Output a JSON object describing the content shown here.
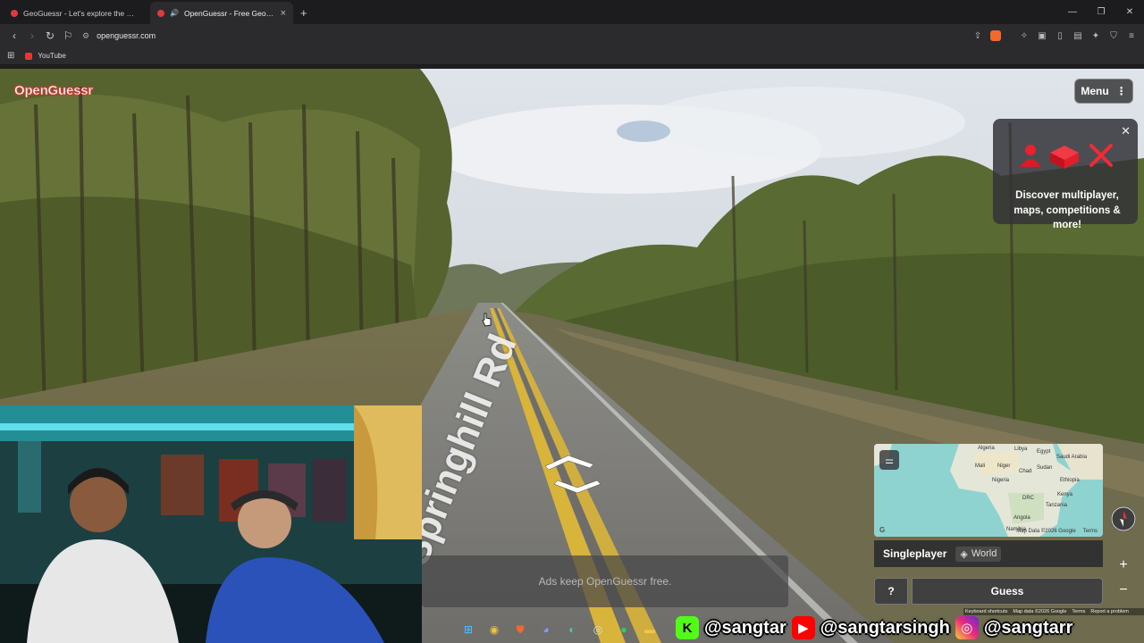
{
  "browser": {
    "tabs": [
      {
        "title": "GeoGuessr - Let's explore the world!",
        "active": false
      },
      {
        "title": "OpenGuessr - Free GeoGuessr",
        "active": true
      }
    ],
    "url": "openguessr.com",
    "bookmarks": [
      {
        "label": "YouTube"
      }
    ]
  },
  "game": {
    "logo": "OpenGuessr",
    "menu_label": "Menu",
    "promo_text": "Discover multiplayer, maps, competitions & more!",
    "road_name": "Springhill Rd",
    "ads_text": "Ads keep OpenGuessr free.",
    "mode": "Singleplayer",
    "map_name": "World",
    "help_label": "?",
    "guess_label": "Guess",
    "minimap": {
      "labels": [
        "Algeria",
        "Libya",
        "Egypt",
        "Saudi Arabia",
        "Mali",
        "Niger",
        "Sudan",
        "Chad",
        "Nigeria",
        "Ethiopia",
        "DRC",
        "Kenya",
        "Tanzania",
        "Angola",
        "Namibia"
      ],
      "attribution": "Map Data ©2026 Google",
      "terms": "Terms"
    },
    "map_footer": [
      "Keyboard shortcuts",
      "Map data ©2026 Google",
      "Terms",
      "Report a problem"
    ]
  },
  "stream": {
    "kick": "@sangtar",
    "youtube": "@sangtarsingh",
    "instagram": "@sangtarr"
  }
}
